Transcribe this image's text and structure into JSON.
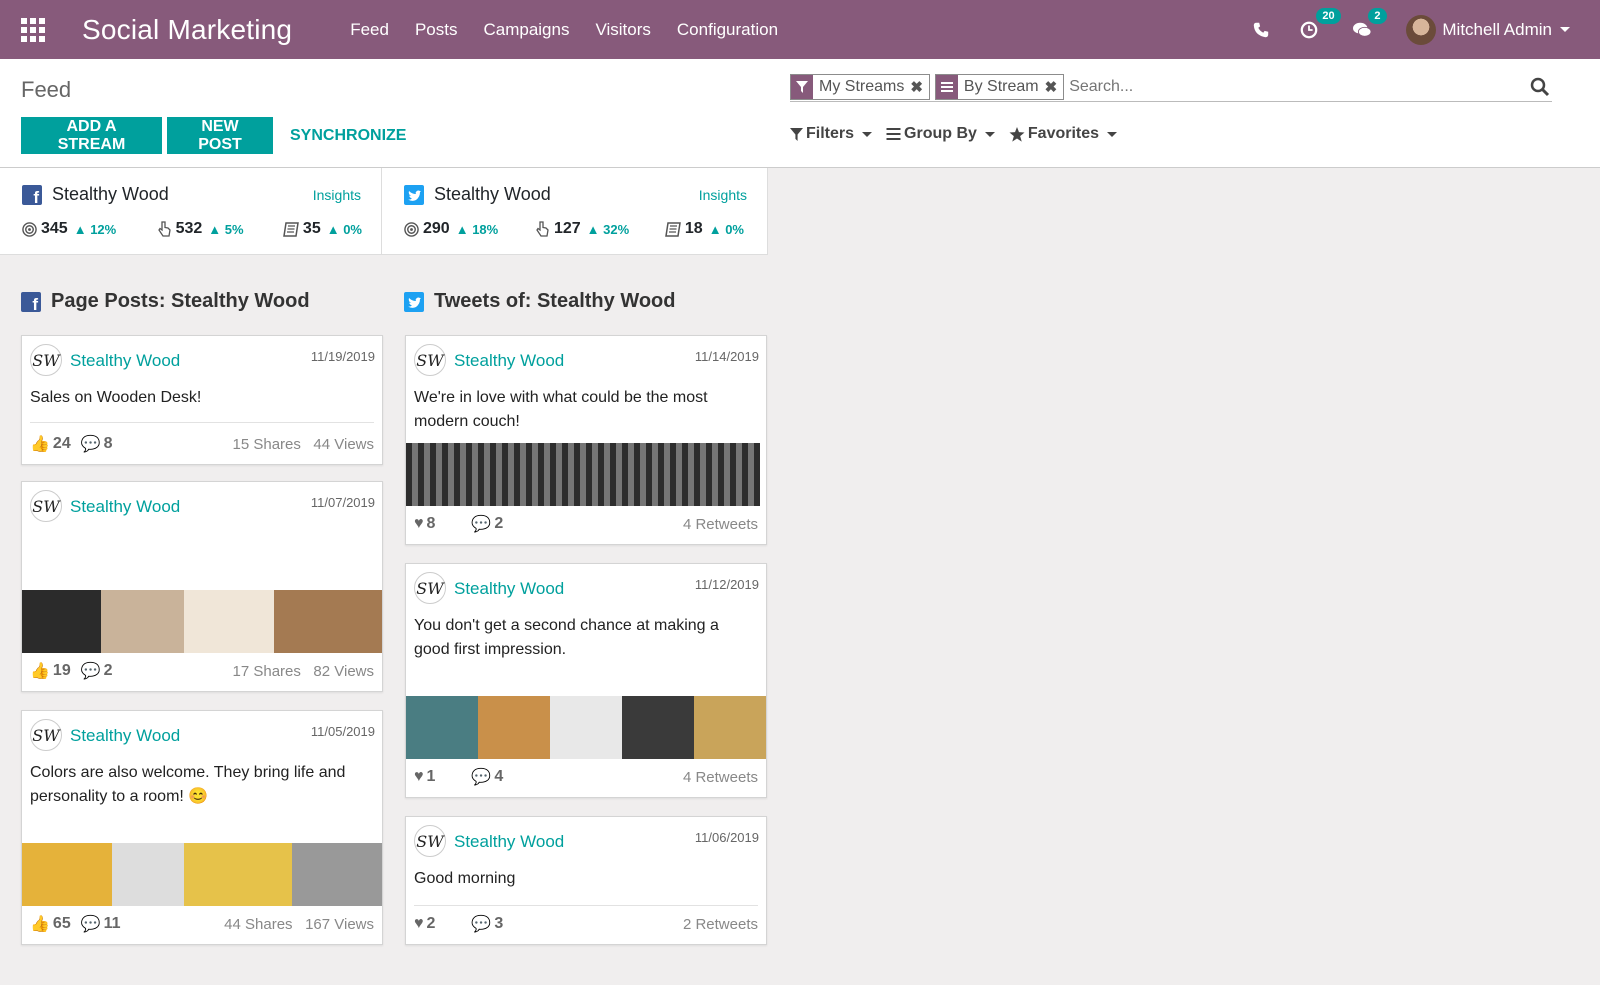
{
  "app": {
    "title": "Social Marketing"
  },
  "nav": [
    "Feed",
    "Posts",
    "Campaigns",
    "Visitors",
    "Configuration"
  ],
  "user": {
    "name": "Mitchell Admin",
    "activity_count": "20",
    "message_count": "2"
  },
  "control": {
    "breadcrumb": "Feed",
    "add_stream": "ADD A STREAM",
    "new_post": "NEW POST",
    "synchronize": "SYNCHRONIZE",
    "facets": [
      "My Streams",
      "By Stream"
    ],
    "search_placeholder": "Search...",
    "filters": "Filters",
    "group_by": "Group By",
    "favorites": "Favorites"
  },
  "accounts": [
    {
      "network": "facebook",
      "name": "Stealthy Wood",
      "insights": "Insights",
      "stats": [
        {
          "value": "345",
          "trend": "12%"
        },
        {
          "value": "532",
          "trend": "5%"
        },
        {
          "value": "35",
          "trend": "0%"
        }
      ]
    },
    {
      "network": "twitter",
      "name": "Stealthy Wood",
      "insights": "Insights",
      "stats": [
        {
          "value": "290",
          "trend": "18%"
        },
        {
          "value": "127",
          "trend": "32%"
        },
        {
          "value": "18",
          "trend": "0%"
        }
      ]
    }
  ],
  "columns": [
    {
      "title": "Page Posts: Stealthy Wood",
      "posts": [
        {
          "author": "Stealthy Wood",
          "date": "11/19/2019",
          "message": "Sales on Wooden Desk!",
          "likes": "24",
          "comments": "8",
          "shares": "15 Shares",
          "views": "44 Views"
        },
        {
          "author": "Stealthy Wood",
          "date": "11/07/2019",
          "message": "",
          "likes": "19",
          "comments": "2",
          "shares": "17 Shares",
          "views": "82 Views"
        },
        {
          "author": "Stealthy Wood",
          "date": "11/05/2019",
          "message": "Colors are also welcome. They bring life and personality to a room! 😊",
          "likes": "65",
          "comments": "11",
          "shares": "44 Shares",
          "views": "167 Views"
        }
      ]
    },
    {
      "title": "Tweets of: Stealthy Wood",
      "posts": [
        {
          "author": "Stealthy Wood",
          "date": "11/14/2019",
          "message": "We're in love with what could be the most modern couch!",
          "likes": "8",
          "comments": "2",
          "retweets": "4 Retweets"
        },
        {
          "author": "Stealthy Wood",
          "date": "11/12/2019",
          "message": "You don't get a second chance at making a good first impression.",
          "likes": "1",
          "comments": "4",
          "retweets": "4 Retweets"
        },
        {
          "author": "Stealthy Wood",
          "date": "11/06/2019",
          "message": "Good morning",
          "likes": "2",
          "comments": "3",
          "retweets": "2 Retweets"
        }
      ]
    }
  ],
  "colors": {
    "brand": "#875a7b",
    "accent": "#00a09d",
    "facebook": "#3b5998",
    "twitter": "#1da1f2"
  }
}
